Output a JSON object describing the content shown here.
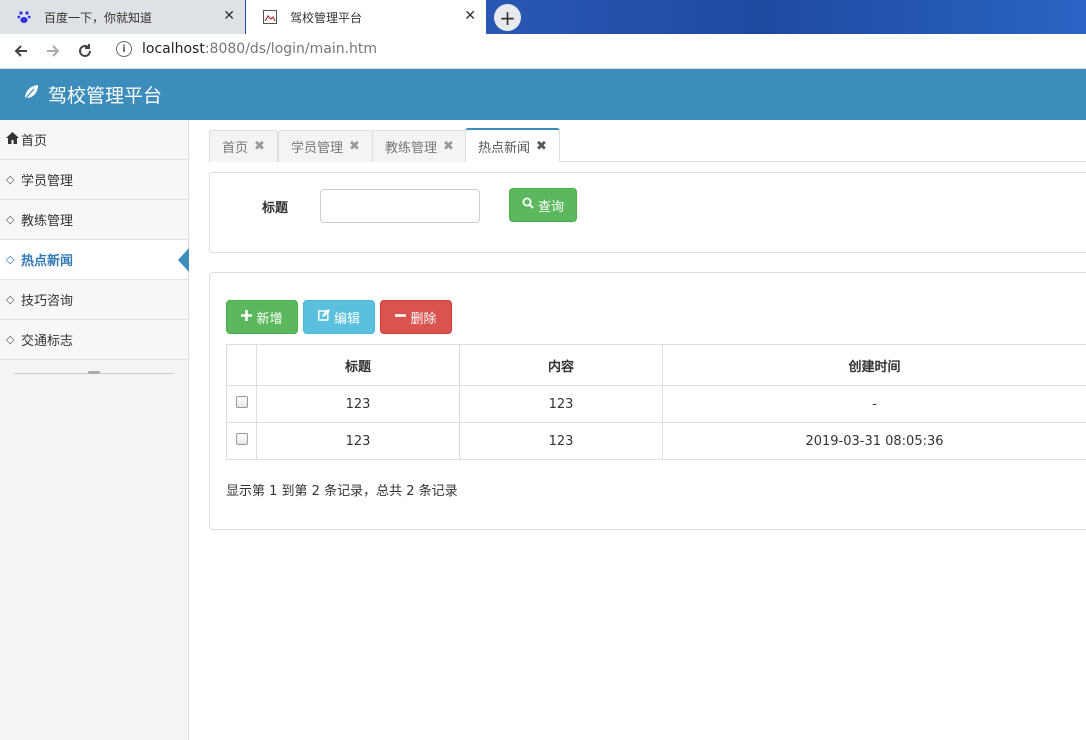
{
  "browser": {
    "tabs": [
      {
        "title": "百度一下，你就知道",
        "favicon": "baidu-paw-icon"
      },
      {
        "title": "驾校管理平台",
        "favicon": "page-image-icon"
      }
    ],
    "close_glyph": "✕",
    "newtab_glyph": "+",
    "url_host": "localhost",
    "url_path": ":8080/ds/login/main.htm"
  },
  "app": {
    "title": "驾校管理平台",
    "header_color": "#3c8dbc"
  },
  "sidebar": {
    "items": [
      {
        "label": "首页",
        "icon": "home-icon"
      },
      {
        "label": "学员管理",
        "icon": "diamond-icon"
      },
      {
        "label": "教练管理",
        "icon": "diamond-icon"
      },
      {
        "label": "热点新闻",
        "icon": "diamond-icon"
      },
      {
        "label": "技巧咨询",
        "icon": "diamond-icon"
      },
      {
        "label": "交通标志",
        "icon": "diamond-icon"
      }
    ]
  },
  "content_tabs": [
    {
      "label": "首页"
    },
    {
      "label": "学员管理"
    },
    {
      "label": "教练管理"
    },
    {
      "label": "热点新闻"
    }
  ],
  "search": {
    "label": "标题",
    "value": "",
    "placeholder": "",
    "button": "查询"
  },
  "toolbar": {
    "add": "新增",
    "edit": "编辑",
    "delete": "删除"
  },
  "table": {
    "headers": [
      "标题",
      "内容",
      "创建时间"
    ],
    "rows": [
      [
        "123",
        "123",
        "-"
      ],
      [
        "123",
        "123",
        "2019-03-31 08:05:36"
      ]
    ]
  },
  "pagination": {
    "info": "显示第 1 到第 2 条记录，总共 2 条记录"
  }
}
